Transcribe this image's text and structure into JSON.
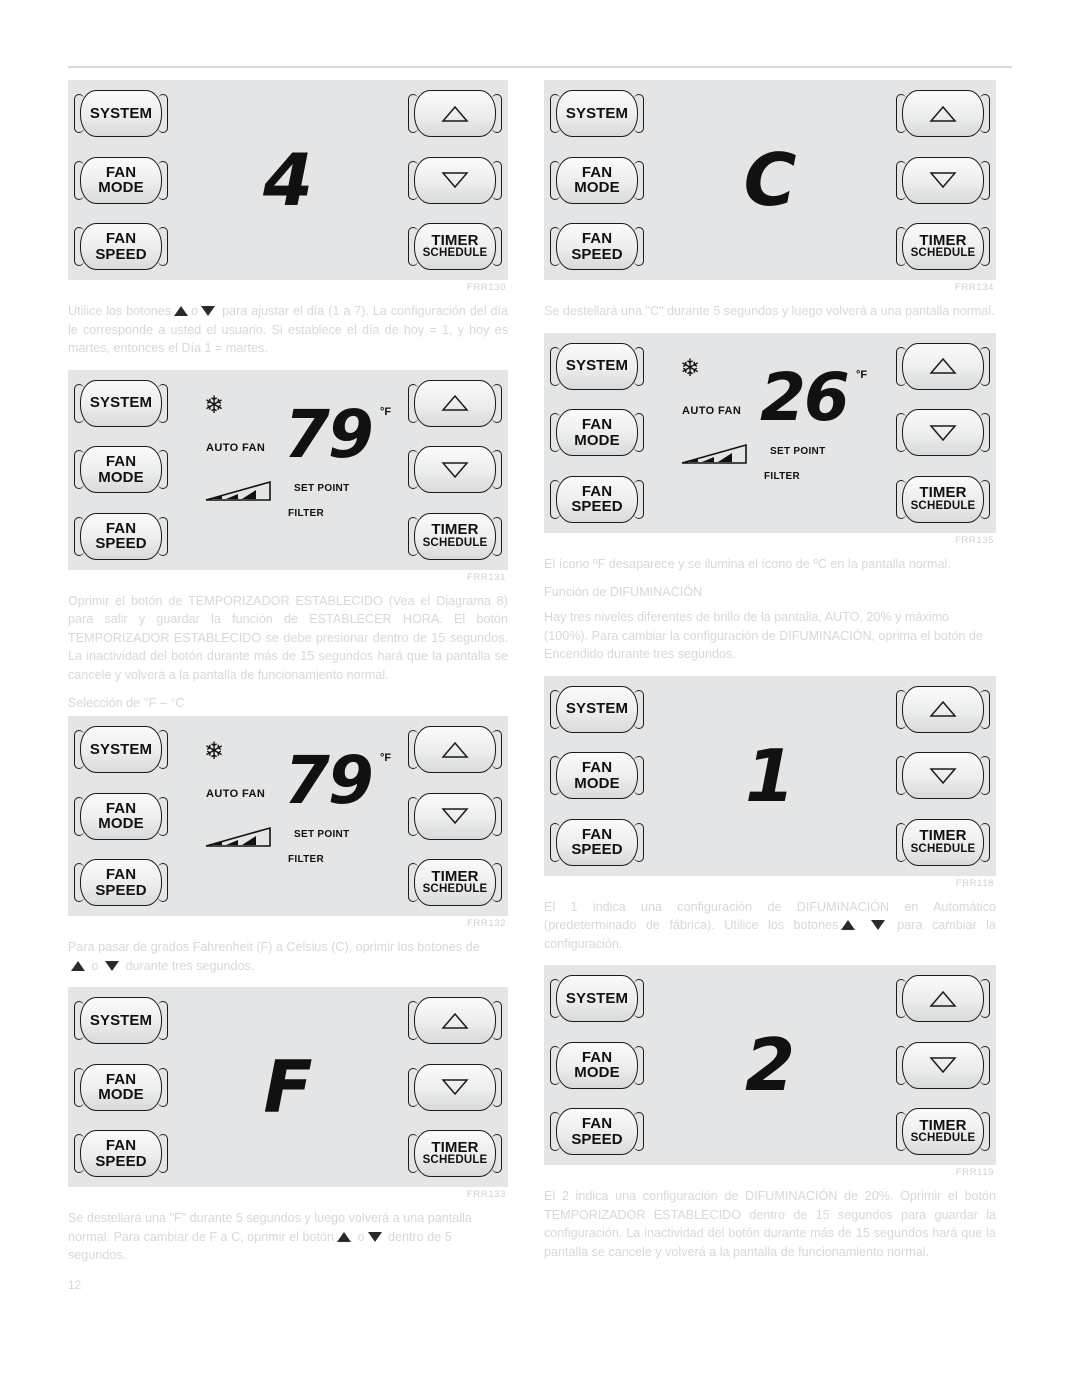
{
  "page": {
    "number": "12",
    "language": "es"
  },
  "thermostat_buttons": {
    "system": "SYSTEM",
    "fan_mode_line1": "FAN",
    "fan_mode_line2": "MODE",
    "fan_speed_line1": "FAN",
    "fan_speed_line2": "SPEED",
    "timer_line1": "TIMER",
    "timer_line2": "SCHEDULE",
    "up_icon": "triangle-up-icon",
    "down_icon": "triangle-down-icon"
  },
  "lcd_labels": {
    "auto_fan": "AUTO FAN",
    "set_point": "SET POINT",
    "filter": "FILTER",
    "degree_f": "°F",
    "snowflake_icon": "snowflake-icon"
  },
  "figures": [
    {
      "id": "fig-day-4",
      "label": "FRR130",
      "display": "4",
      "display_type": "digit-only",
      "has_lcd_extras": false
    },
    {
      "id": "fig-79-f-first",
      "label": "FRR131",
      "display": "79",
      "display_type": "temperature",
      "unit": "°F",
      "has_lcd_extras": true
    },
    {
      "id": "fig-79-f-second",
      "label": "FRR132",
      "display": "79",
      "display_type": "temperature",
      "unit": "°F",
      "has_lcd_extras": true
    },
    {
      "id": "fig-letter-f",
      "label": "FRR133",
      "display": "F",
      "display_type": "digit-only",
      "has_lcd_extras": false
    },
    {
      "id": "fig-letter-c",
      "label": "FRR134",
      "display": "C",
      "display_type": "digit-only",
      "has_lcd_extras": false
    },
    {
      "id": "fig-26-c",
      "label": "FRR135",
      "display": "26",
      "display_type": "temperature",
      "unit": "°F",
      "has_lcd_extras": true
    },
    {
      "id": "fig-dim-1",
      "label": "FRR118",
      "display": "1",
      "display_type": "digit-only",
      "has_lcd_extras": false
    },
    {
      "id": "fig-dim-2",
      "label": "FRR119",
      "display": "2",
      "display_type": "digit-only",
      "has_lcd_extras": false
    }
  ],
  "left_column": {
    "para_day_setting_a": "Utilice los botones",
    "para_day_setting_b": "o",
    "para_day_setting_c": "para ajustar el día (1 a 7). La configuración del día le corresponde a usted el usuario. Si establece el día de hoy = 1, y hoy es martes, entonces el Día 1 = martes.",
    "para_timer_set": "Oprimir el botón de TEMPORIZADOR ESTABLECIDO (Vea el Diagrama 8) para salir y guardar la función de ESTABLECER HORA. El botón TEMPORIZADOR ESTABLECIDO se debe presionar dentro de 15 segundos. La inactividad del botón durante más de 15 segundos hará que la pantalla se cancele y volverá a la pantalla de funcionamiento normal.",
    "heading_f_c": "Selección de °F – °C",
    "para_switch_a": "Para pasar de grados Fahrenheit (F) a Celsius (C), oprimir los botones de",
    "para_switch_b": "o",
    "para_switch_c": "durante tres segundos.",
    "para_flash_f_a": "Se destellará una \"F\" durante 5 segundos y luego volverá a una pantalla normal. Para cambiar de F a C, oprimir el botón",
    "para_flash_f_b": "o",
    "para_flash_f_c": "dentro de 5 segundos."
  },
  "right_column": {
    "para_flash_c": "Se destellará una \"C\" durante 5 segundos y luego volverá a una pantalla normal.",
    "para_icon_swap": "El ícono ºF desaparece y se ilumina el ícono de ºC en la pantalla normal.",
    "heading_dim": "Función de DIFUMINACIÓN",
    "para_dim_levels": "Hay tres niveles diferentes de brillo de la pantalla, AUTO, 20% y máximo (100%). Para cambiar la configuración de DIFUMINACIÓN, oprima el botón de Encendido durante tres segundos.",
    "para_dim_1_a": "El 1 indica una configuración de DIFUMINACIÓN en Automático (predeterminado de fábrica). Utilice los botones",
    "para_dim_1_b": "",
    "para_dim_1_c": "para cambiar la configuración.",
    "para_dim_2": "El 2 indica una configuración de DIFUMINACIÓN de 20%. Oprimir el botón TEMPORIZADOR ESTABLECIDO dentro de 15 segundos para guardar la configuración. La inactividad del botón durante más de 15 segundos hará que la pantalla se cancele y volverá a la pantalla de funcionamiento normal."
  },
  "colors": {
    "panel_bg": "#e3e5e6",
    "text": "#d6d8d9",
    "figure_label": "#cfd1d2",
    "lcd_segment": "#111111"
  }
}
